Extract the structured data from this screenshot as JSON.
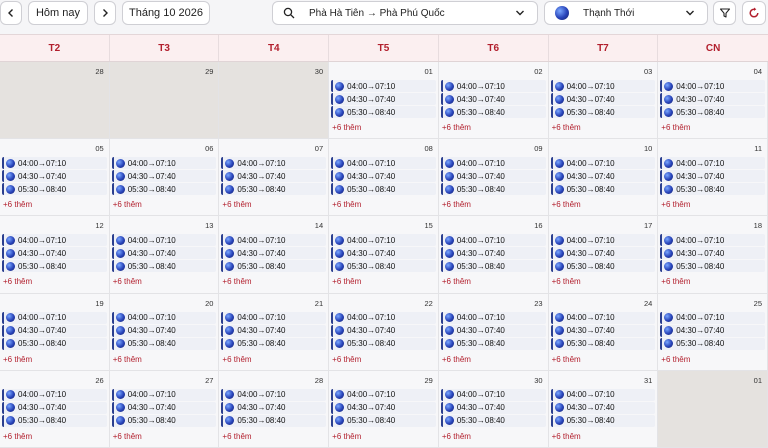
{
  "toolbar": {
    "today_label": "Hôm nay",
    "month_label": "Tháng 10 2026",
    "route_value": "Phà Hà Tiên → Phà Phú Quốc",
    "operator_value": "Thạnh Thới"
  },
  "weekdays": [
    "T2",
    "T3",
    "T4",
    "T5",
    "T6",
    "T7",
    "CN"
  ],
  "event_times": [
    "04:00→07:10",
    "04:30→07:40",
    "05:30→08:40"
  ],
  "more_label": "+6 thêm",
  "weeks": [
    [
      {
        "day": "28",
        "in_month": false
      },
      {
        "day": "29",
        "in_month": false
      },
      {
        "day": "30",
        "in_month": false
      },
      {
        "day": "01",
        "in_month": true
      },
      {
        "day": "02",
        "in_month": true
      },
      {
        "day": "03",
        "in_month": true
      },
      {
        "day": "04",
        "in_month": true
      }
    ],
    [
      {
        "day": "05",
        "in_month": true
      },
      {
        "day": "06",
        "in_month": true
      },
      {
        "day": "07",
        "in_month": true
      },
      {
        "day": "08",
        "in_month": true
      },
      {
        "day": "09",
        "in_month": true
      },
      {
        "day": "10",
        "in_month": true
      },
      {
        "day": "11",
        "in_month": true
      }
    ],
    [
      {
        "day": "12",
        "in_month": true
      },
      {
        "day": "13",
        "in_month": true
      },
      {
        "day": "14",
        "in_month": true
      },
      {
        "day": "15",
        "in_month": true
      },
      {
        "day": "16",
        "in_month": true
      },
      {
        "day": "17",
        "in_month": true
      },
      {
        "day": "18",
        "in_month": true
      }
    ],
    [
      {
        "day": "19",
        "in_month": true
      },
      {
        "day": "20",
        "in_month": true
      },
      {
        "day": "21",
        "in_month": true
      },
      {
        "day": "22",
        "in_month": true
      },
      {
        "day": "23",
        "in_month": true
      },
      {
        "day": "24",
        "in_month": true
      },
      {
        "day": "25",
        "in_month": true
      }
    ],
    [
      {
        "day": "26",
        "in_month": true
      },
      {
        "day": "27",
        "in_month": true
      },
      {
        "day": "28",
        "in_month": true
      },
      {
        "day": "29",
        "in_month": true
      },
      {
        "day": "30",
        "in_month": true
      },
      {
        "day": "31",
        "in_month": true
      },
      {
        "day": "01",
        "in_month": false
      }
    ]
  ],
  "colors": {
    "accent": "#b21f2d",
    "event_border": "#2b3f8f"
  }
}
